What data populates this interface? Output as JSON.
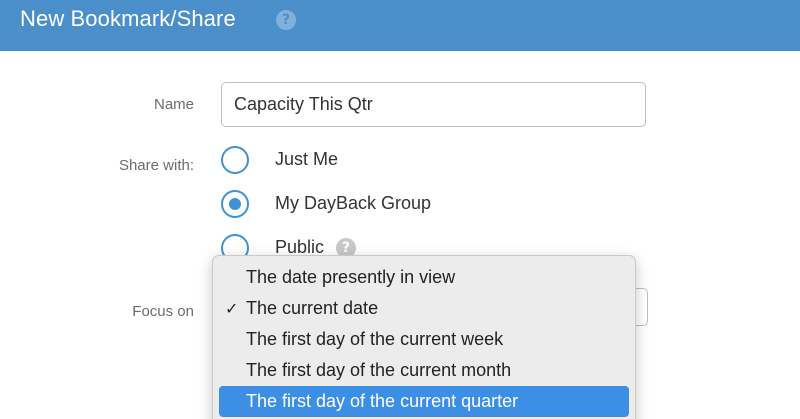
{
  "header": {
    "title": "New Bookmark/Share",
    "help_glyph": "?"
  },
  "form": {
    "name_label": "Name",
    "name_value": "Capacity This Qtr",
    "share_label": "Share with:",
    "share_options": [
      {
        "label": "Just Me",
        "selected": false
      },
      {
        "label": "My DayBack Group",
        "selected": true
      },
      {
        "label": "Public",
        "selected": false
      }
    ],
    "public_help_glyph": "?",
    "focus_label": "Focus on"
  },
  "focus_dropdown": {
    "check_glyph": "✓",
    "options": [
      {
        "label": "The date presently in view",
        "checked": false,
        "highlighted": false
      },
      {
        "label": "The current date",
        "checked": true,
        "highlighted": false
      },
      {
        "label": "The first day of the current week",
        "checked": false,
        "highlighted": false
      },
      {
        "label": "The first day of the current month",
        "checked": false,
        "highlighted": false
      },
      {
        "label": "The first day of the current quarter",
        "checked": false,
        "highlighted": true
      }
    ]
  },
  "colors": {
    "header_bg": "#4a8fc9",
    "radio_accent": "#3f93d5",
    "highlight": "#3d8fe6"
  }
}
